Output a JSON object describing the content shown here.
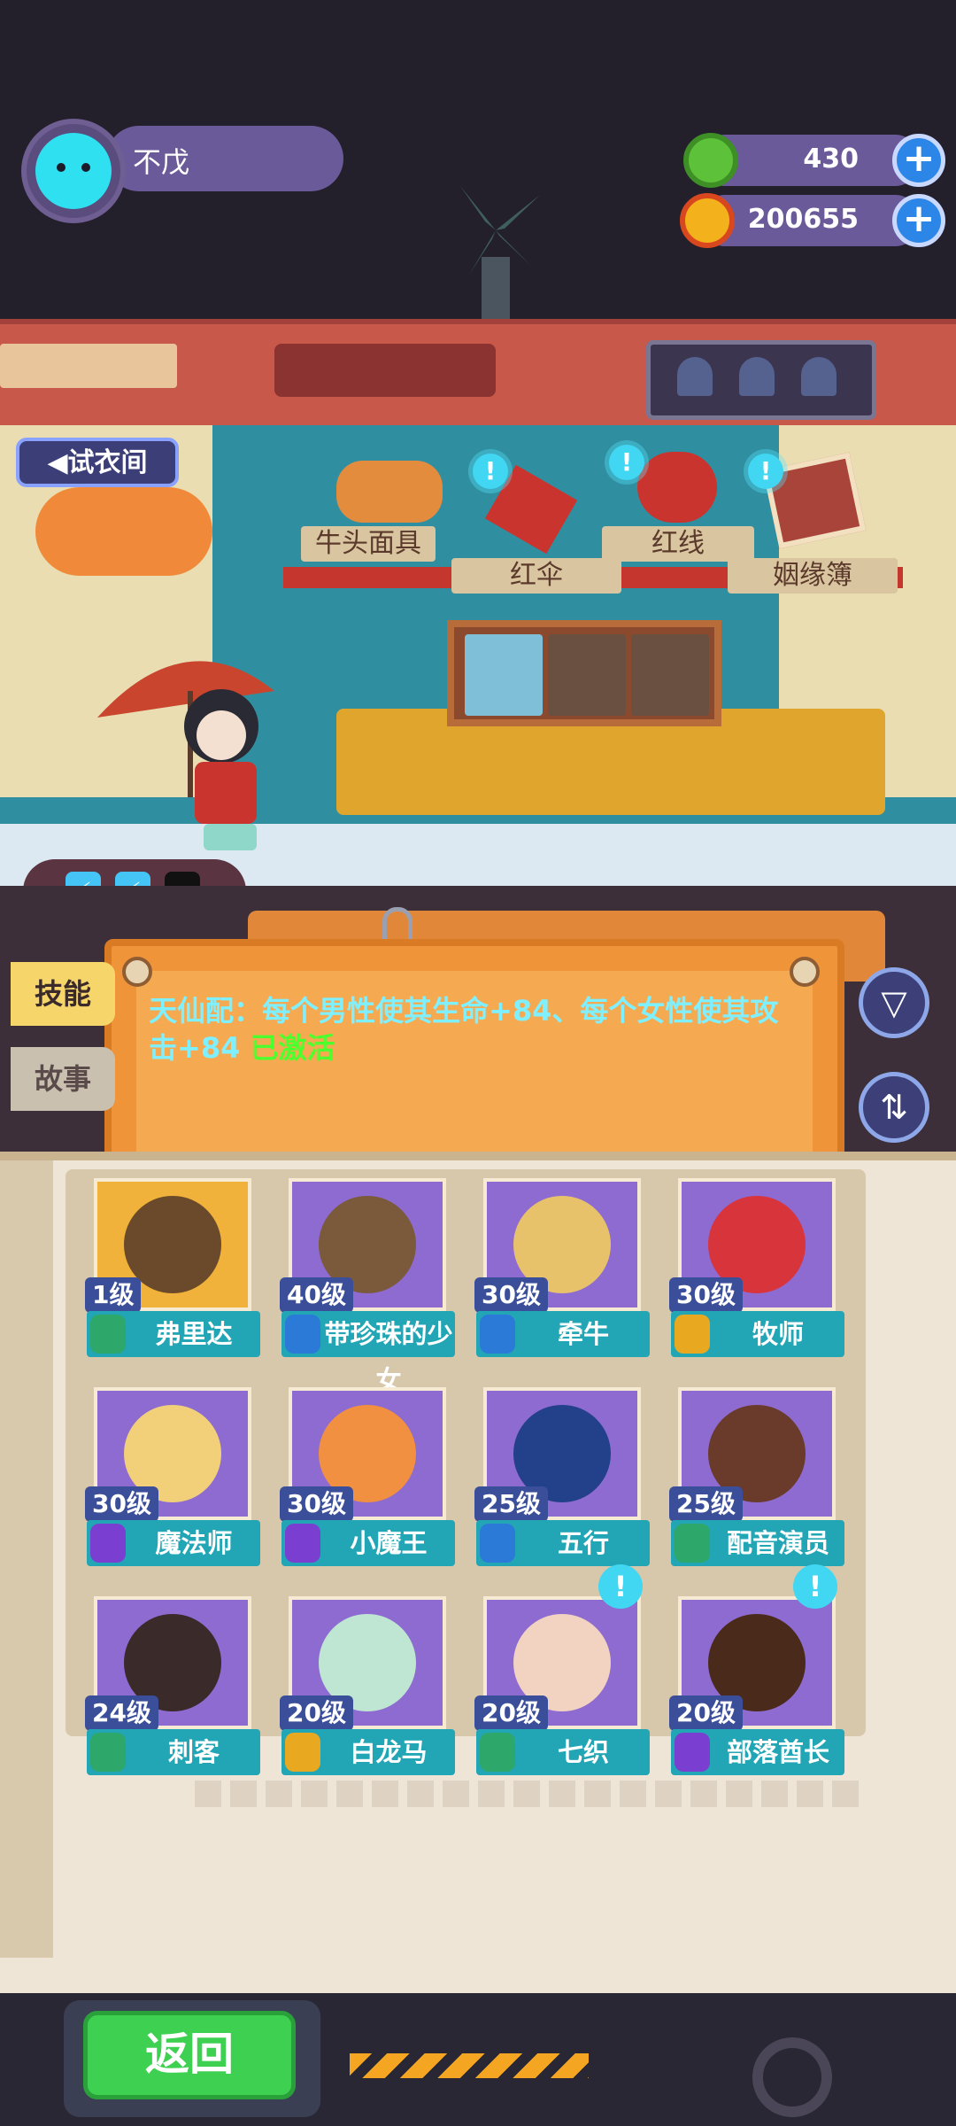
{
  "player": {
    "name": "不戊"
  },
  "currency": [
    {
      "icon": "green-coin-icon",
      "amount": "430"
    },
    {
      "icon": "gold-planet-icon",
      "amount": "200655"
    }
  ],
  "scene": {
    "fitting_room_label": "试衣间",
    "items": [
      "牛头面具",
      "红伞",
      "红线",
      "姻缘簿"
    ]
  },
  "info": {
    "synergy_text": "天仙配：每个男性使其生命+84、每个女性使其攻击+84",
    "synergy_status": "已激活",
    "tabs": [
      "技能",
      "故事"
    ]
  },
  "characters": [
    {
      "level": "1级",
      "name": "弗里达",
      "badge_color": "#2ea86a",
      "bg": "#f0b23a",
      "head": "#6a4a2a"
    },
    {
      "level": "40级",
      "name": "带珍珠的少女",
      "badge_color": "#2b7ad8",
      "bg": "#8d6bd1",
      "head": "#7a5a3a"
    },
    {
      "level": "30级",
      "name": "牵牛",
      "badge_color": "#2b7ad8",
      "bg": "#8d6bd1",
      "head": "#e8c26a"
    },
    {
      "level": "30级",
      "name": "牧师",
      "badge_color": "#e8a820",
      "bg": "#8d6bd1",
      "head": "#d8343c"
    },
    {
      "level": "30级",
      "name": "魔法师",
      "badge_color": "#7a3fd0",
      "bg": "#8d6bd1",
      "head": "#f2d07a"
    },
    {
      "level": "30级",
      "name": "小魔王",
      "badge_color": "#7a3fd0",
      "bg": "#8d6bd1",
      "head": "#f09040"
    },
    {
      "level": "25级",
      "name": "五行",
      "badge_color": "#2b7ad8",
      "bg": "#8d6bd1",
      "head": "#23408a"
    },
    {
      "level": "25级",
      "name": "配音演员",
      "badge_color": "#2ea86a",
      "bg": "#8d6bd1",
      "head": "#6a3a2a"
    },
    {
      "level": "24级",
      "name": "刺客",
      "badge_color": "#2ea86a",
      "bg": "#8d6bd1",
      "head": "#3a2a2a"
    },
    {
      "level": "20级",
      "name": "白龙马",
      "badge_color": "#e8a820",
      "bg": "#8d6bd1",
      "head": "#bfe6d2"
    },
    {
      "level": "20级",
      "name": "七织",
      "badge_color": "#2ea86a",
      "bg": "#8d6bd1",
      "head": "#f2d2c0"
    },
    {
      "level": "20级",
      "name": "部落酋长",
      "badge_color": "#7a3fd0",
      "bg": "#8d6bd1",
      "head": "#4a2a1a"
    }
  ],
  "footer": {
    "back_label": "返回"
  },
  "colors": {
    "accent_teal": "#22a6b5",
    "synergy_text": "#7ff0ff",
    "activated": "#4dff2d",
    "back_button": "#3ed050"
  }
}
